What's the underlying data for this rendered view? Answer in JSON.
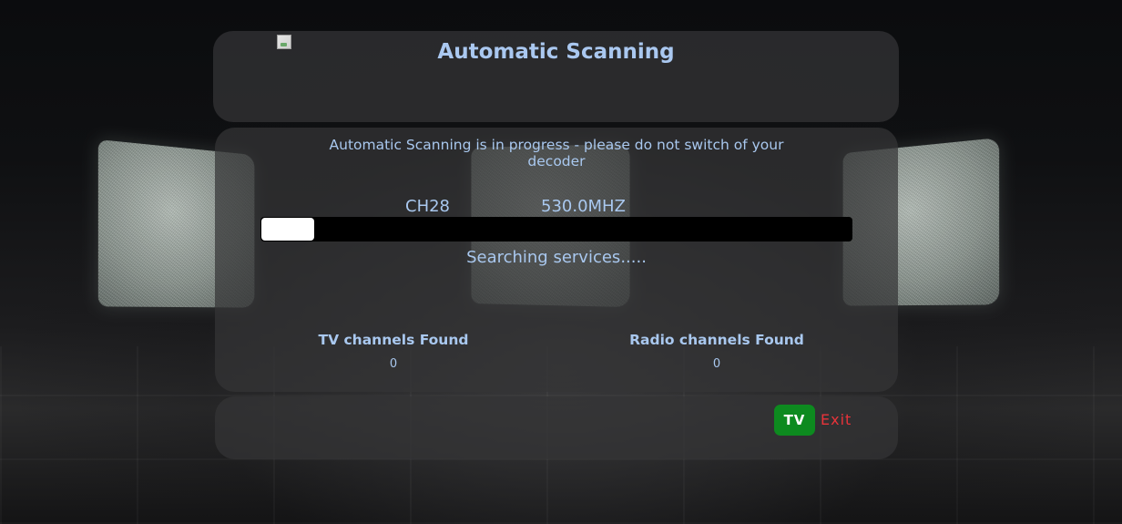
{
  "header": {
    "title": "Automatic Scanning"
  },
  "scan": {
    "notice": "Automatic Scanning is in progress - please do not switch of your decoder",
    "channel": "CH28",
    "frequency": "530.0MHZ",
    "progress_fraction": 0.09,
    "status": "Searching services....."
  },
  "results": {
    "tv_label": "TV channels Found",
    "tv_count": "0",
    "radio_label": "Radio channels Found",
    "radio_count": "0"
  },
  "footer": {
    "tv_button_label": "TV",
    "exit_label": "Exit"
  },
  "colors": {
    "accent_text": "#a9c8ef",
    "tv_button": "#0d8a1f",
    "exit": "#e8333a",
    "progress_track": "#000000",
    "progress_fill": "#ffffff"
  }
}
